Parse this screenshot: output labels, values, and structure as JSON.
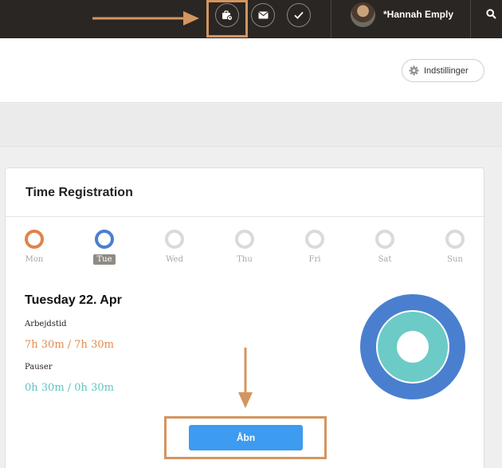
{
  "topbar": {
    "user_name": "*Hannah Emply",
    "icons": [
      "briefcase-clock-icon",
      "envelope-icon",
      "checkmark-icon",
      "search-icon"
    ]
  },
  "header": {
    "settings_label": "Indstillinger"
  },
  "time_registration": {
    "title": "Time Registration",
    "days": [
      {
        "label": "Mon",
        "state": "done",
        "color": "#e0834a"
      },
      {
        "label": "Tue",
        "state": "active",
        "color": "#4a7fd0"
      },
      {
        "label": "Wed",
        "state": "empty",
        "color": "#dadada"
      },
      {
        "label": "Thu",
        "state": "empty",
        "color": "#dadada"
      },
      {
        "label": "Fri",
        "state": "empty",
        "color": "#dadada"
      },
      {
        "label": "Sat",
        "state": "empty",
        "color": "#dadada"
      },
      {
        "label": "Sun",
        "state": "empty",
        "color": "#dadada"
      }
    ],
    "date_title": "Tuesday 22. Apr",
    "work_label": "Arbejdstid",
    "work_value": "7h 30m / 7h 30m",
    "break_label": "Pauser",
    "break_value": "0h 30m / 0h 30m",
    "open_button": "Åbn"
  },
  "colors": {
    "work": "#e58a4e",
    "break": "#5cc6c4",
    "donut_outer": "#4a7fd0",
    "donut_inner": "#6ccbc6",
    "button": "#3d9bf0",
    "annotation": "#d4955f"
  }
}
